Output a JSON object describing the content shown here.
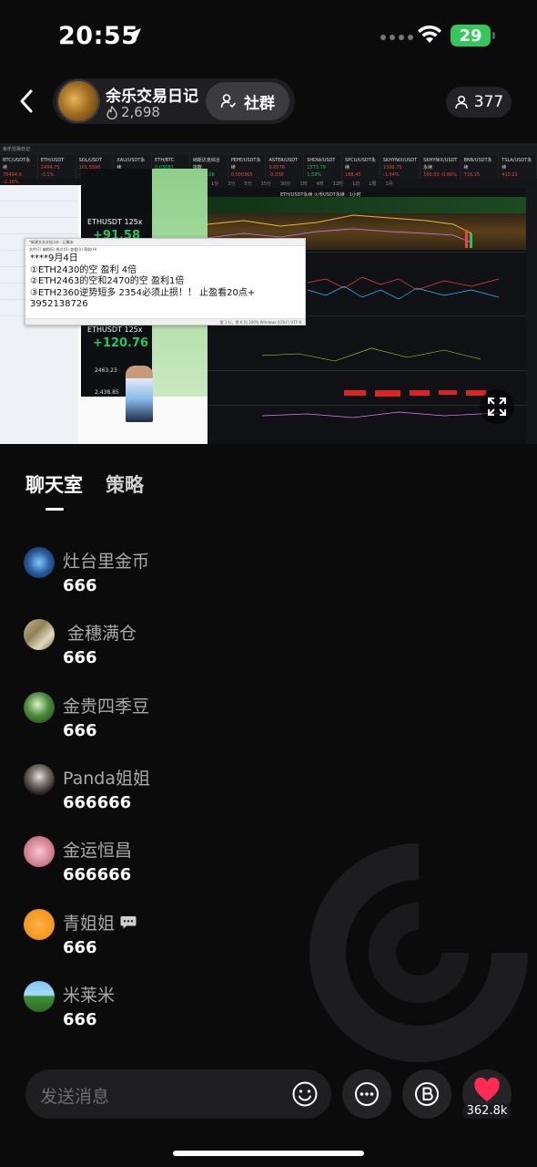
{
  "status_bar": {
    "time": "20:55",
    "battery": "29"
  },
  "header": {
    "host_name": "余乐交易日记",
    "likes": "2,698",
    "group_label": "社群",
    "viewers": "377"
  },
  "video": {
    "topbar_text": "余乐交易日记",
    "tickers": [
      {
        "sym": "BTC/USDT永续",
        "val": "79494.9 -2.16%",
        "dir": "dn"
      },
      {
        "sym": "ETH/USDT",
        "val": "2494.75 -3.1%",
        "dir": "dn"
      },
      {
        "sym": "SOL/USDT",
        "val": "101.5596 -2.0",
        "dir": "dn"
      },
      {
        "sym": "XAU/USDT永续",
        "val": "4499.93 -1.7%",
        "dir": "dn"
      },
      {
        "sym": "ETH/BTC",
        "val": "0.03087 0.03%",
        "dir": "up"
      },
      {
        "sym": "纳斯达克综合指数",
        "val": "26584.06 0.001",
        "dir": "up"
      },
      {
        "sym": "PEPE/USDT永续",
        "val": "0.000365 -4.5%",
        "dir": "dn"
      },
      {
        "sym": "ASTER/USDT",
        "val": "0.6576 -0.038",
        "dir": "dn"
      },
      {
        "sym": "SHDW/USDT",
        "val": "1573.79 1.59%",
        "dir": "up"
      },
      {
        "sym": "SPCU/USDT永续",
        "val": "168.45 -0.96%",
        "dir": "dn"
      },
      {
        "sym": "SKHYNIX/USDT",
        "val": "1399.75 -1.04%",
        "dir": "dn"
      },
      {
        "sym": "SKHYNIX/USDT永续",
        "val": "160.03 -0.66%",
        "dir": "dn"
      },
      {
        "sym": "BNB/USDT永续",
        "val": "716.15 -1.27%",
        "dir": "dn"
      },
      {
        "sym": "TSLA/USDT永续",
        "val": "410.21 -1.76%",
        "dir": "dn"
      }
    ],
    "timeframes": [
      "1分",
      "3分",
      "5分",
      "15分",
      "30分",
      "1时",
      "4时",
      "12时",
      "1日",
      "1周",
      "1月"
    ],
    "pnl_top_label": "ETHUSDT  125x",
    "pnl_top_value": "+91.58",
    "pnl_bottom_label": "ETHUSDT  125x",
    "pnl_bottom_value": "+120.76",
    "pnl_price_1": "2463.23",
    "pnl_price_2": "2,438.85",
    "notepad_title": "*新建文本文档.txt - 记事本",
    "notepad_menu": "文件(F)  编辑(E)  格式(O)  查看(V)  帮助(H)",
    "notepad_lines": [
      "****9月4日",
      "①ETH2430的空   盈利 4倍",
      "②ETH2463的空和2470的空  盈利1倍",
      "③ETH2360逆势短多 2354必须止损！！ 止盈看20点+",
      "3952138726"
    ],
    "notepad_status": "第 1 行，第 6 列    100%    Windows (CRLF)    UTF-8",
    "chart_symbol": "ETH/USDT永续 火币USDT永续 · 1小时"
  },
  "tabs": [
    {
      "label": "聊天室"
    },
    {
      "label": "策略"
    }
  ],
  "messages": [
    {
      "name": "灶台里金币",
      "text": "666"
    },
    {
      "name": "金穗满仓",
      "text": "666"
    },
    {
      "name": "金贵四季豆",
      "text": "666"
    },
    {
      "name": "Panda姐姐",
      "text": "666666"
    },
    {
      "name": "金运恒昌",
      "text": "666666"
    },
    {
      "name": "青姐姐",
      "text": "666"
    },
    {
      "name": "米莱米",
      "text": "666"
    }
  ],
  "composer": {
    "placeholder": "发送消息",
    "like_count": "362.8k"
  },
  "colors": {
    "accent_heart": "#fe2c55",
    "battery": "#34c759",
    "profit_green": "#22c55e"
  }
}
